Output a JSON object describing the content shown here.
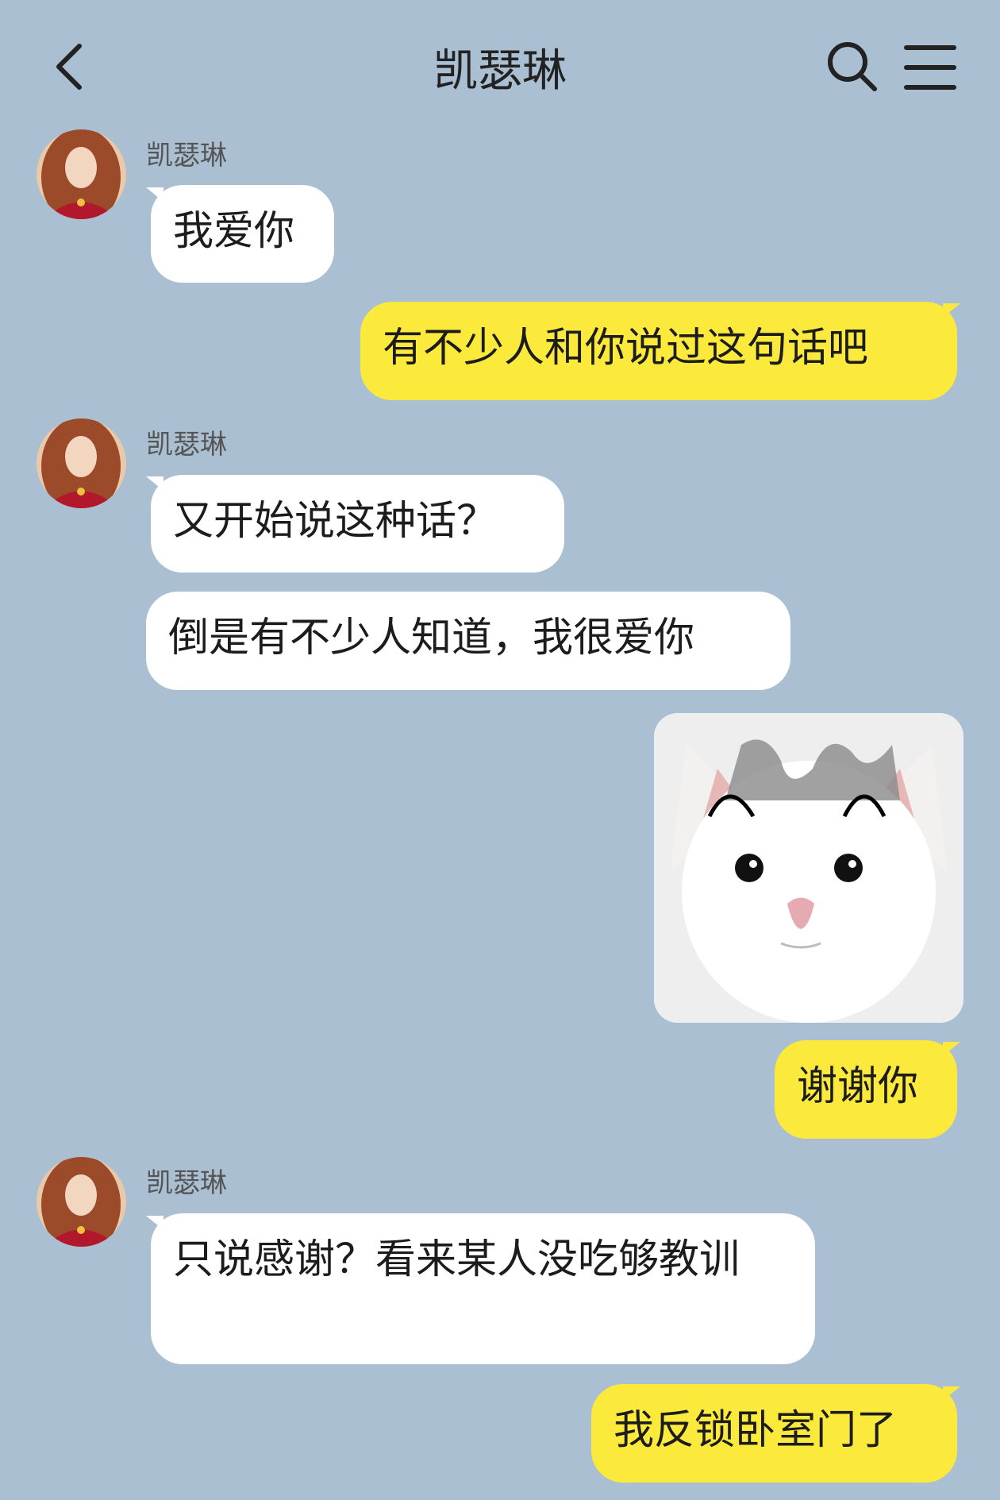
{
  "header": {
    "title": "凯瑟琳",
    "back_icon": "chevron-left-icon",
    "search_icon": "search-icon",
    "menu_icon": "hamburger-menu-icon"
  },
  "colors": {
    "background": "#aabfd2",
    "incoming_bubble": "#ffffff",
    "outgoing_bubble": "#fbea3b"
  },
  "messages": [
    {
      "from": "contact",
      "sender": "凯瑟琳",
      "text": "我爱你"
    },
    {
      "from": "me",
      "text": "有不少人和你说过这句话吧"
    },
    {
      "from": "contact",
      "sender": "凯瑟琳",
      "text": "又开始说这种话？"
    },
    {
      "from": "contact",
      "text": "倒是有不少人知道，我很爱你"
    },
    {
      "from": "me",
      "type": "sticker",
      "sticker": "crying-kitten-sticker"
    },
    {
      "from": "me",
      "text": "谢谢你"
    },
    {
      "from": "contact",
      "sender": "凯瑟琳",
      "text": "只说感谢？看来某人没吃够教训"
    },
    {
      "from": "me",
      "text": "我反锁卧室门了"
    }
  ]
}
